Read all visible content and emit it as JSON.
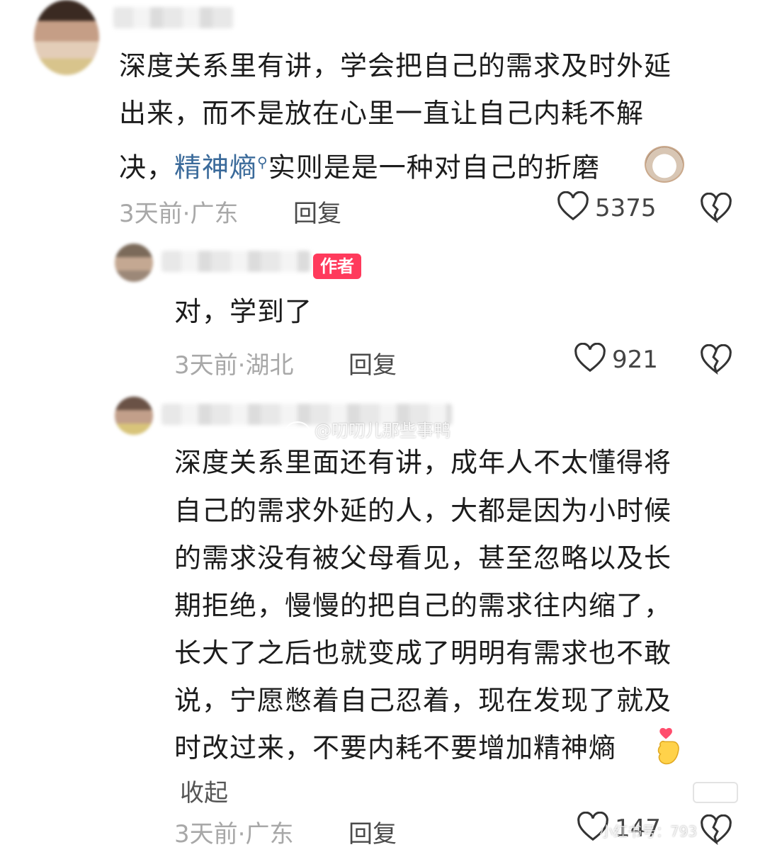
{
  "comments": [
    {
      "text_lines": [
        "深度关系里有讲，学会把自己的需求及时外延",
        "出来，而不是放在心里一直让自己内耗不解"
      ],
      "line3_prefix": "决，",
      "line3_link": "精神熵",
      "line3_suffix": "实则是是一种对自己的折磨",
      "time": "3天前·广东",
      "reply": "回复",
      "likes": "5375"
    },
    {
      "badge": "作者",
      "text": "对，学到了",
      "time": "3天前·湖北",
      "reply": "回复",
      "likes": "921"
    },
    {
      "text_lines": [
        "深度关系里面还有讲，成年人不太懂得将",
        "自己的需求外延的人，大都是因为小时候",
        "的需求没有被父母看见，甚至忽略以及长",
        "期拒绝，慢慢的把自己的需求往内缩了，",
        "长大了之后也就变成了明明有需求也不敢",
        "说，宁愿憋着自己忍着，现在发现了就及",
        "时改过来，不要内耗不要增加精神熵"
      ],
      "collapse": "收起",
      "time": "3天前·广东",
      "reply": "回复",
      "likes": "147"
    }
  ],
  "watermark": "@叨叨儿那些事鸭",
  "watermark2": "小红书号：793"
}
